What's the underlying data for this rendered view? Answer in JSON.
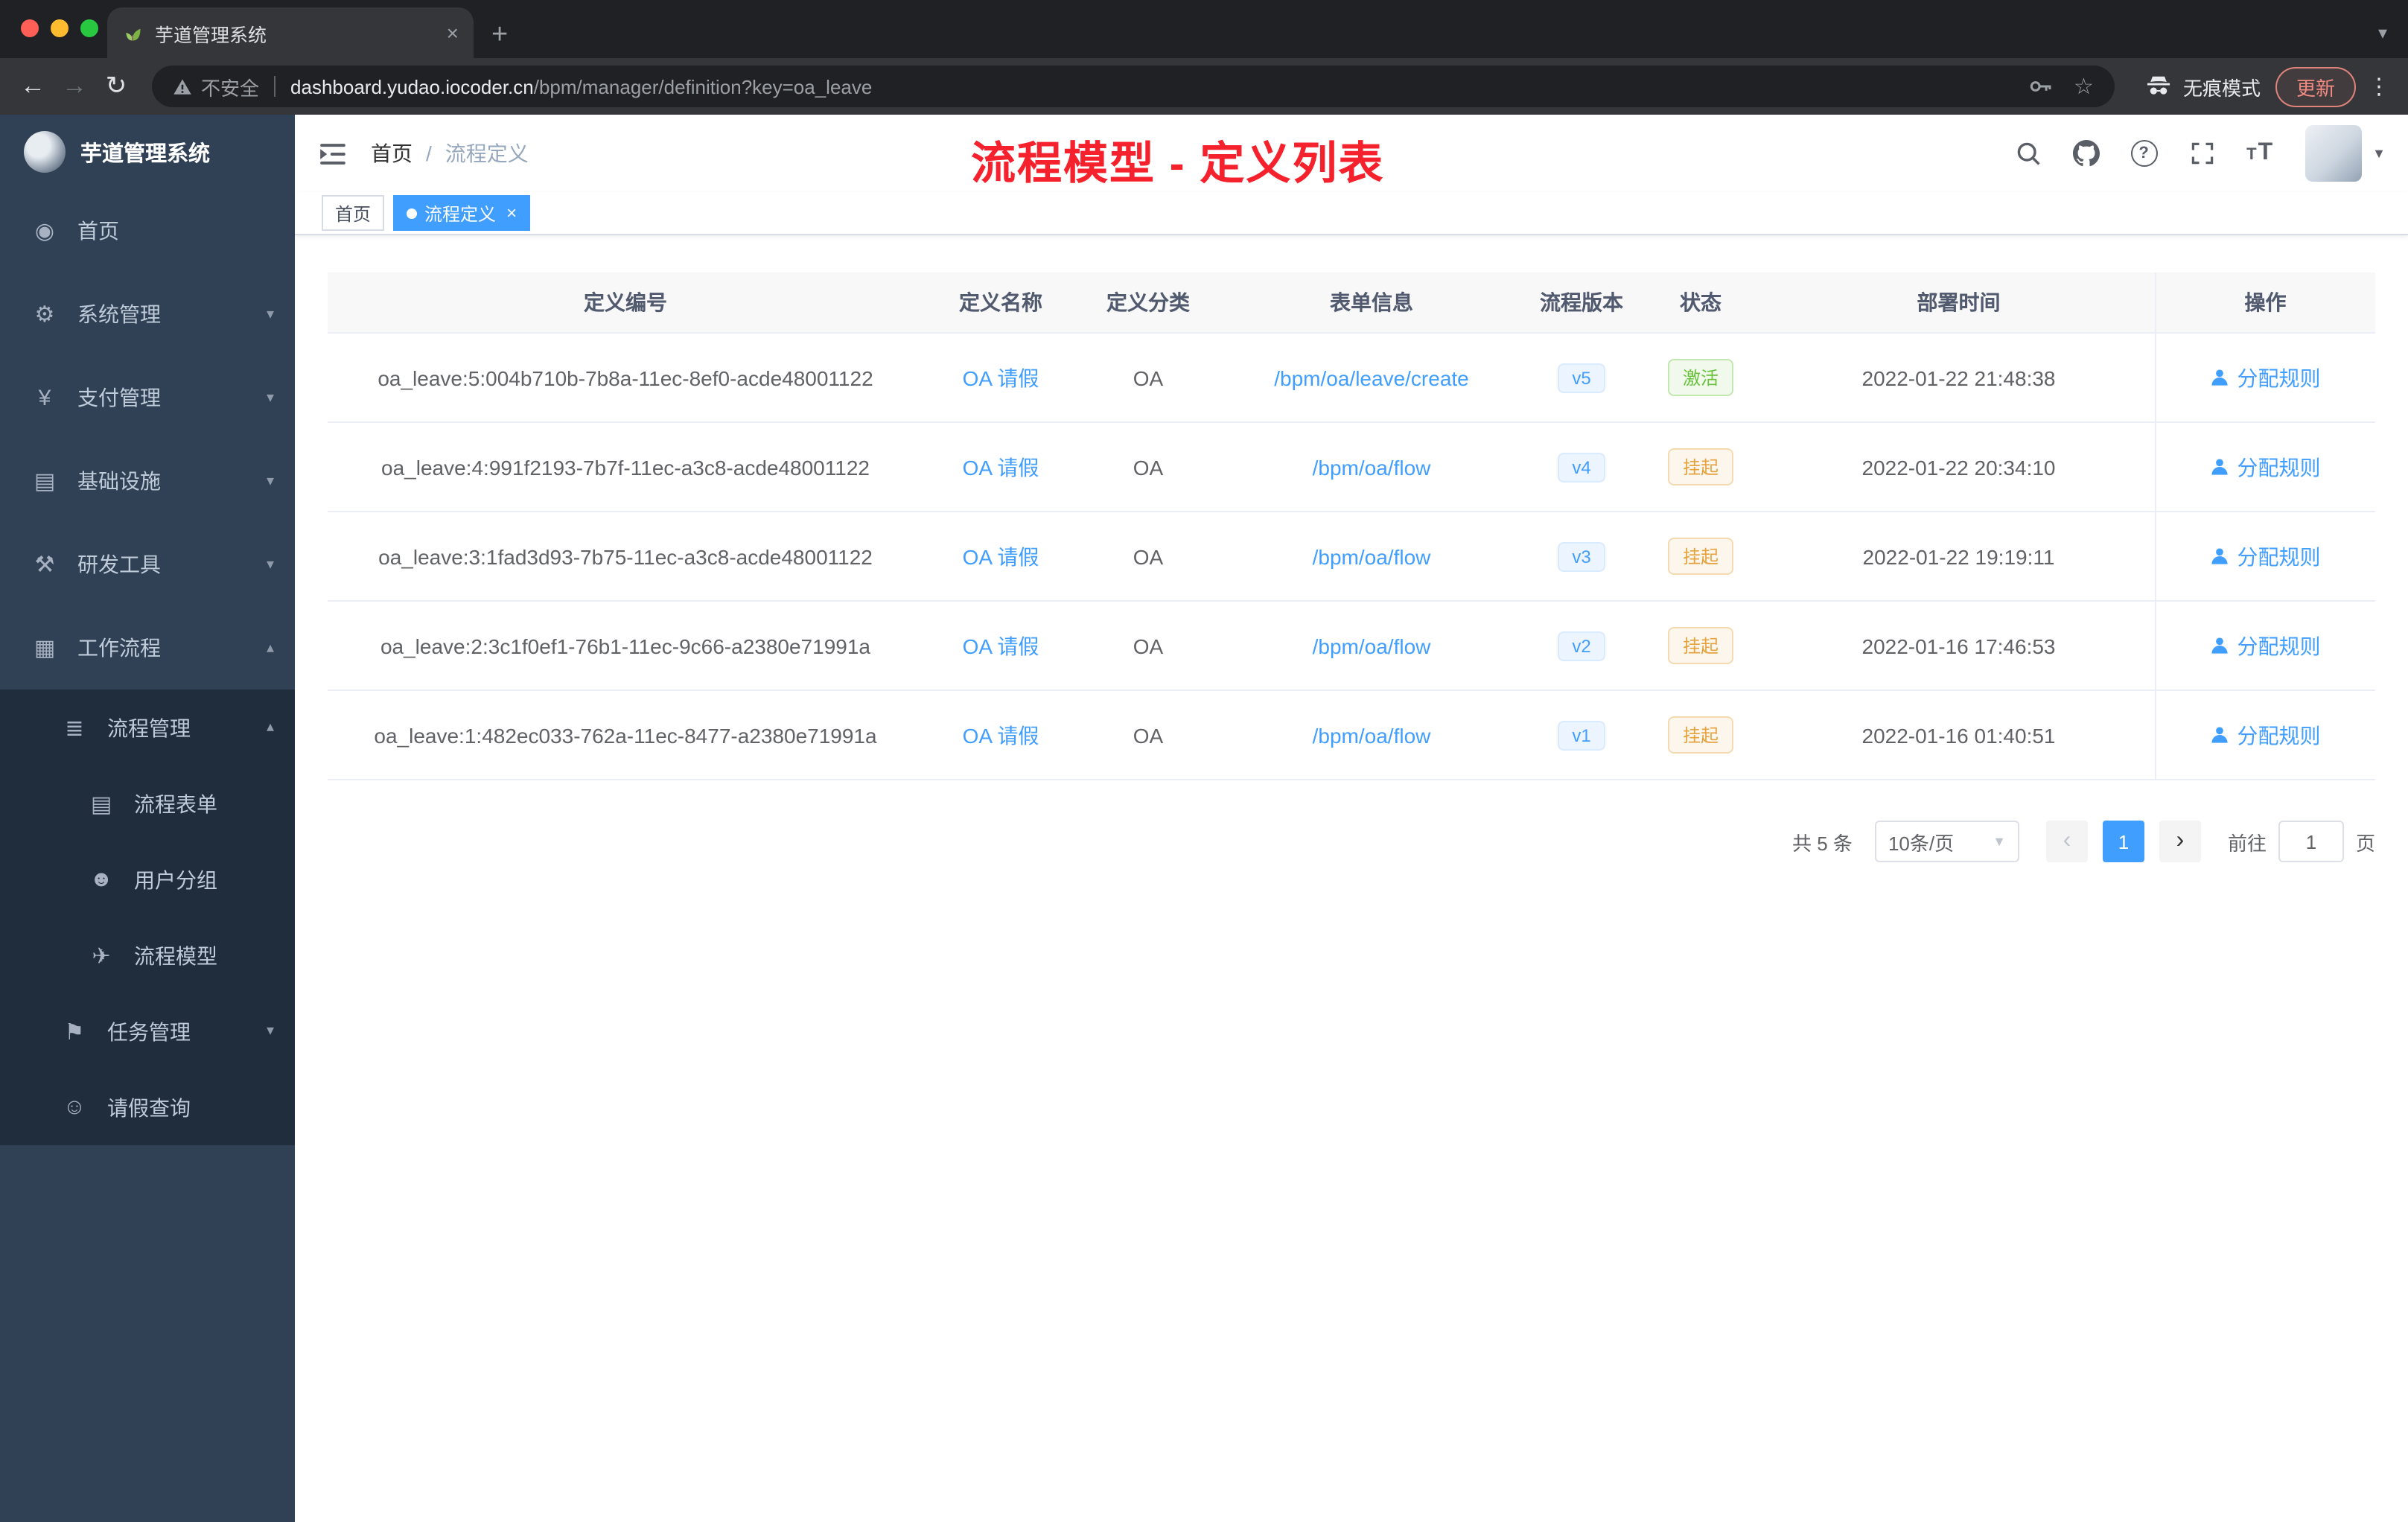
{
  "browser": {
    "tab_title": "芋道管理系统",
    "address": {
      "security_label": "不安全",
      "url_host": "dashboard.yudao.iocoder.cn",
      "url_path": "/bpm/manager/definition?key=oa_leave"
    },
    "incognito_label": "无痕模式",
    "update_label": "更新"
  },
  "sidebar": {
    "logo_title": "芋道管理系统",
    "items": [
      {
        "label": "首页",
        "glyph": "◉"
      },
      {
        "label": "系统管理",
        "glyph": "⚙"
      },
      {
        "label": "支付管理",
        "glyph": "¥"
      },
      {
        "label": "基础设施",
        "glyph": "▤"
      },
      {
        "label": "研发工具",
        "glyph": "⚒"
      },
      {
        "label": "工作流程",
        "glyph": "▦"
      },
      {
        "label": "流程管理",
        "glyph": "≣"
      },
      {
        "label": "流程表单",
        "glyph": "▤"
      },
      {
        "label": "用户分组",
        "glyph": "☻"
      },
      {
        "label": "流程模型",
        "glyph": "✈"
      },
      {
        "label": "任务管理",
        "glyph": "⚑"
      },
      {
        "label": "请假查询",
        "glyph": "☺"
      }
    ]
  },
  "header": {
    "breadcrumb_home": "首页",
    "breadcrumb_sep": "/",
    "breadcrumb_current": "流程定义",
    "annotation": "流程模型 - 定义列表"
  },
  "tags": {
    "home": "首页",
    "current": "流程定义"
  },
  "table": {
    "columns": [
      "定义编号",
      "定义名称",
      "定义分类",
      "表单信息",
      "流程版本",
      "状态",
      "部署时间",
      "操作"
    ],
    "rows": [
      {
        "id": "oa_leave:5:004b710b-7b8a-11ec-8ef0-acde48001122",
        "name": "OA 请假",
        "category": "OA",
        "form": "/bpm/oa/leave/create",
        "version": "v5",
        "status": "激活",
        "status_type": "success",
        "time": "2022-01-22 21:48:38",
        "action": "分配规则"
      },
      {
        "id": "oa_leave:4:991f2193-7b7f-11ec-a3c8-acde48001122",
        "name": "OA 请假",
        "category": "OA",
        "form": "/bpm/oa/flow",
        "version": "v4",
        "status": "挂起",
        "status_type": "warning",
        "time": "2022-01-22 20:34:10",
        "action": "分配规则"
      },
      {
        "id": "oa_leave:3:1fad3d93-7b75-11ec-a3c8-acde48001122",
        "name": "OA 请假",
        "category": "OA",
        "form": "/bpm/oa/flow",
        "version": "v3",
        "status": "挂起",
        "status_type": "warning",
        "time": "2022-01-22 19:19:11",
        "action": "分配规则"
      },
      {
        "id": "oa_leave:2:3c1f0ef1-76b1-11ec-9c66-a2380e71991a",
        "name": "OA 请假",
        "category": "OA",
        "form": "/bpm/oa/flow",
        "version": "v2",
        "status": "挂起",
        "status_type": "warning",
        "time": "2022-01-16 17:46:53",
        "action": "分配规则"
      },
      {
        "id": "oa_leave:1:482ec033-762a-11ec-8477-a2380e71991a",
        "name": "OA 请假",
        "category": "OA",
        "form": "/bpm/oa/flow",
        "version": "v1",
        "status": "挂起",
        "status_type": "warning",
        "time": "2022-01-16 01:40:51",
        "action": "分配规则"
      }
    ]
  },
  "pagination": {
    "total": "共 5 条",
    "page_size": "10条/页",
    "current_page": "1",
    "goto_label": "前往",
    "goto_value": "1",
    "unit_label": "页"
  },
  "colors": {
    "accent": "#409eff",
    "success": "#67c23a",
    "warning": "#e6a23c",
    "annotation_red": "#f5222d",
    "sidebar_bg": "#304156",
    "submenu_bg": "#1f2d3d"
  }
}
